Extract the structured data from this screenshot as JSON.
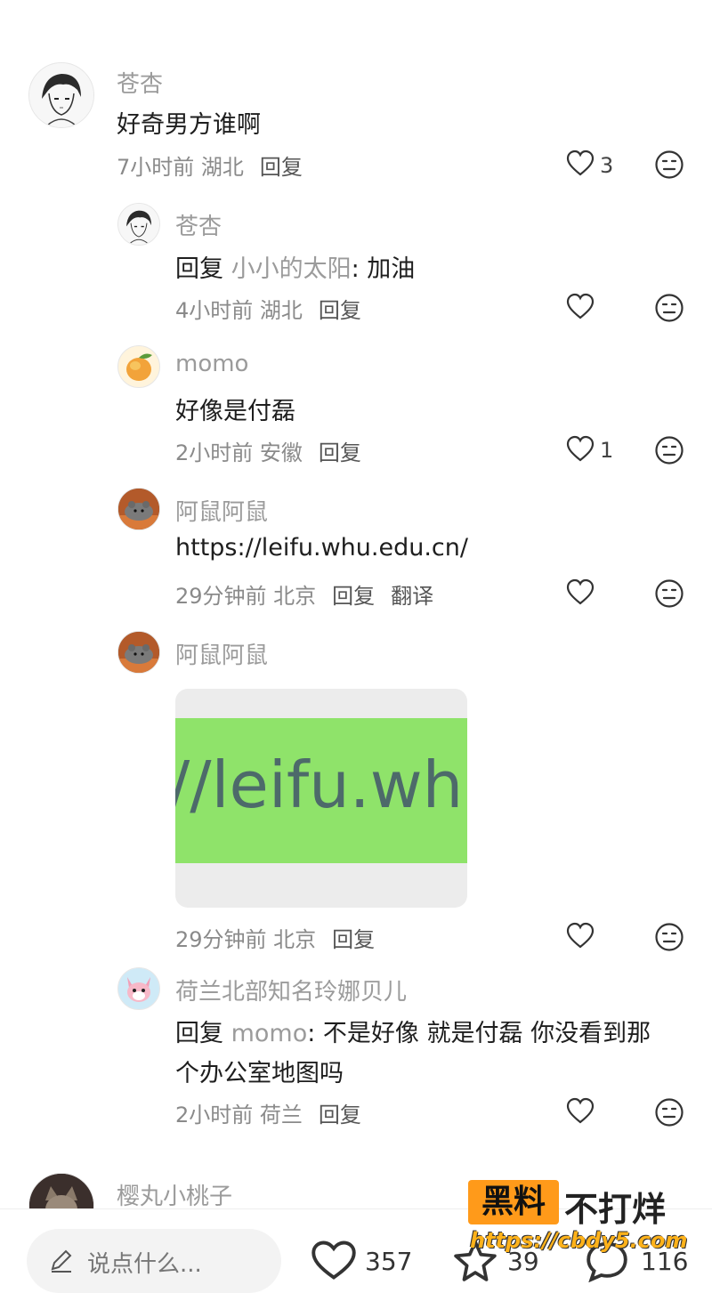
{
  "comments": [
    {
      "username": "苍杏",
      "text": "好奇男方谁啊",
      "meta": "7小时前 湖北",
      "reply_label": "回复",
      "likes": "3",
      "avatar_icon": "anime-boy-sketch-avatar"
    },
    {
      "username": "苍杏",
      "reply_prefix": "回复",
      "mention": "小小的太阳",
      "text": ": 加油",
      "meta": "4小时前 湖北",
      "reply_label": "回复",
      "avatar_icon": "anime-boy-sketch-avatar"
    },
    {
      "username": "momo",
      "text": "好像是付磊",
      "meta": "2小时前 安徽",
      "reply_label": "回复",
      "likes": "1",
      "avatar_icon": "mango-avatar"
    },
    {
      "username": "阿鼠阿鼠",
      "text": "https://leifu.whu.edu.cn/",
      "meta": "29分钟前 北京",
      "reply_label": "回复",
      "translate_label": "翻译",
      "avatar_icon": "hamster-avatar"
    },
    {
      "username": "阿鼠阿鼠",
      "image_text": "//leifu.whu",
      "meta": "29分钟前 北京",
      "reply_label": "回复",
      "avatar_icon": "hamster-avatar"
    },
    {
      "username": "荷兰北部知名玲娜贝儿",
      "reply_prefix": "回复",
      "mention": "momo",
      "text_line1": ": 不是好像 就是付磊 你没看到那",
      "text_line2": "个办公室地图吗",
      "meta": "2小时前 荷兰",
      "reply_label": "回复",
      "avatar_icon": "pink-fox-avatar"
    },
    {
      "username": "樱丸小桃子",
      "avatar_icon": "cat-avatar"
    }
  ],
  "bottom_bar": {
    "input_placeholder": "说点什么...",
    "likes": "357",
    "favorites": "39",
    "comments": "116"
  },
  "watermark": {
    "box_text": "黑料",
    "side_text": "不打烊",
    "url": "https://cbdy5.com"
  },
  "colors": {
    "muted_text": "#9b9b9b",
    "image_green": "#8fe36a",
    "watermark_orange": "#ff9a1a"
  }
}
